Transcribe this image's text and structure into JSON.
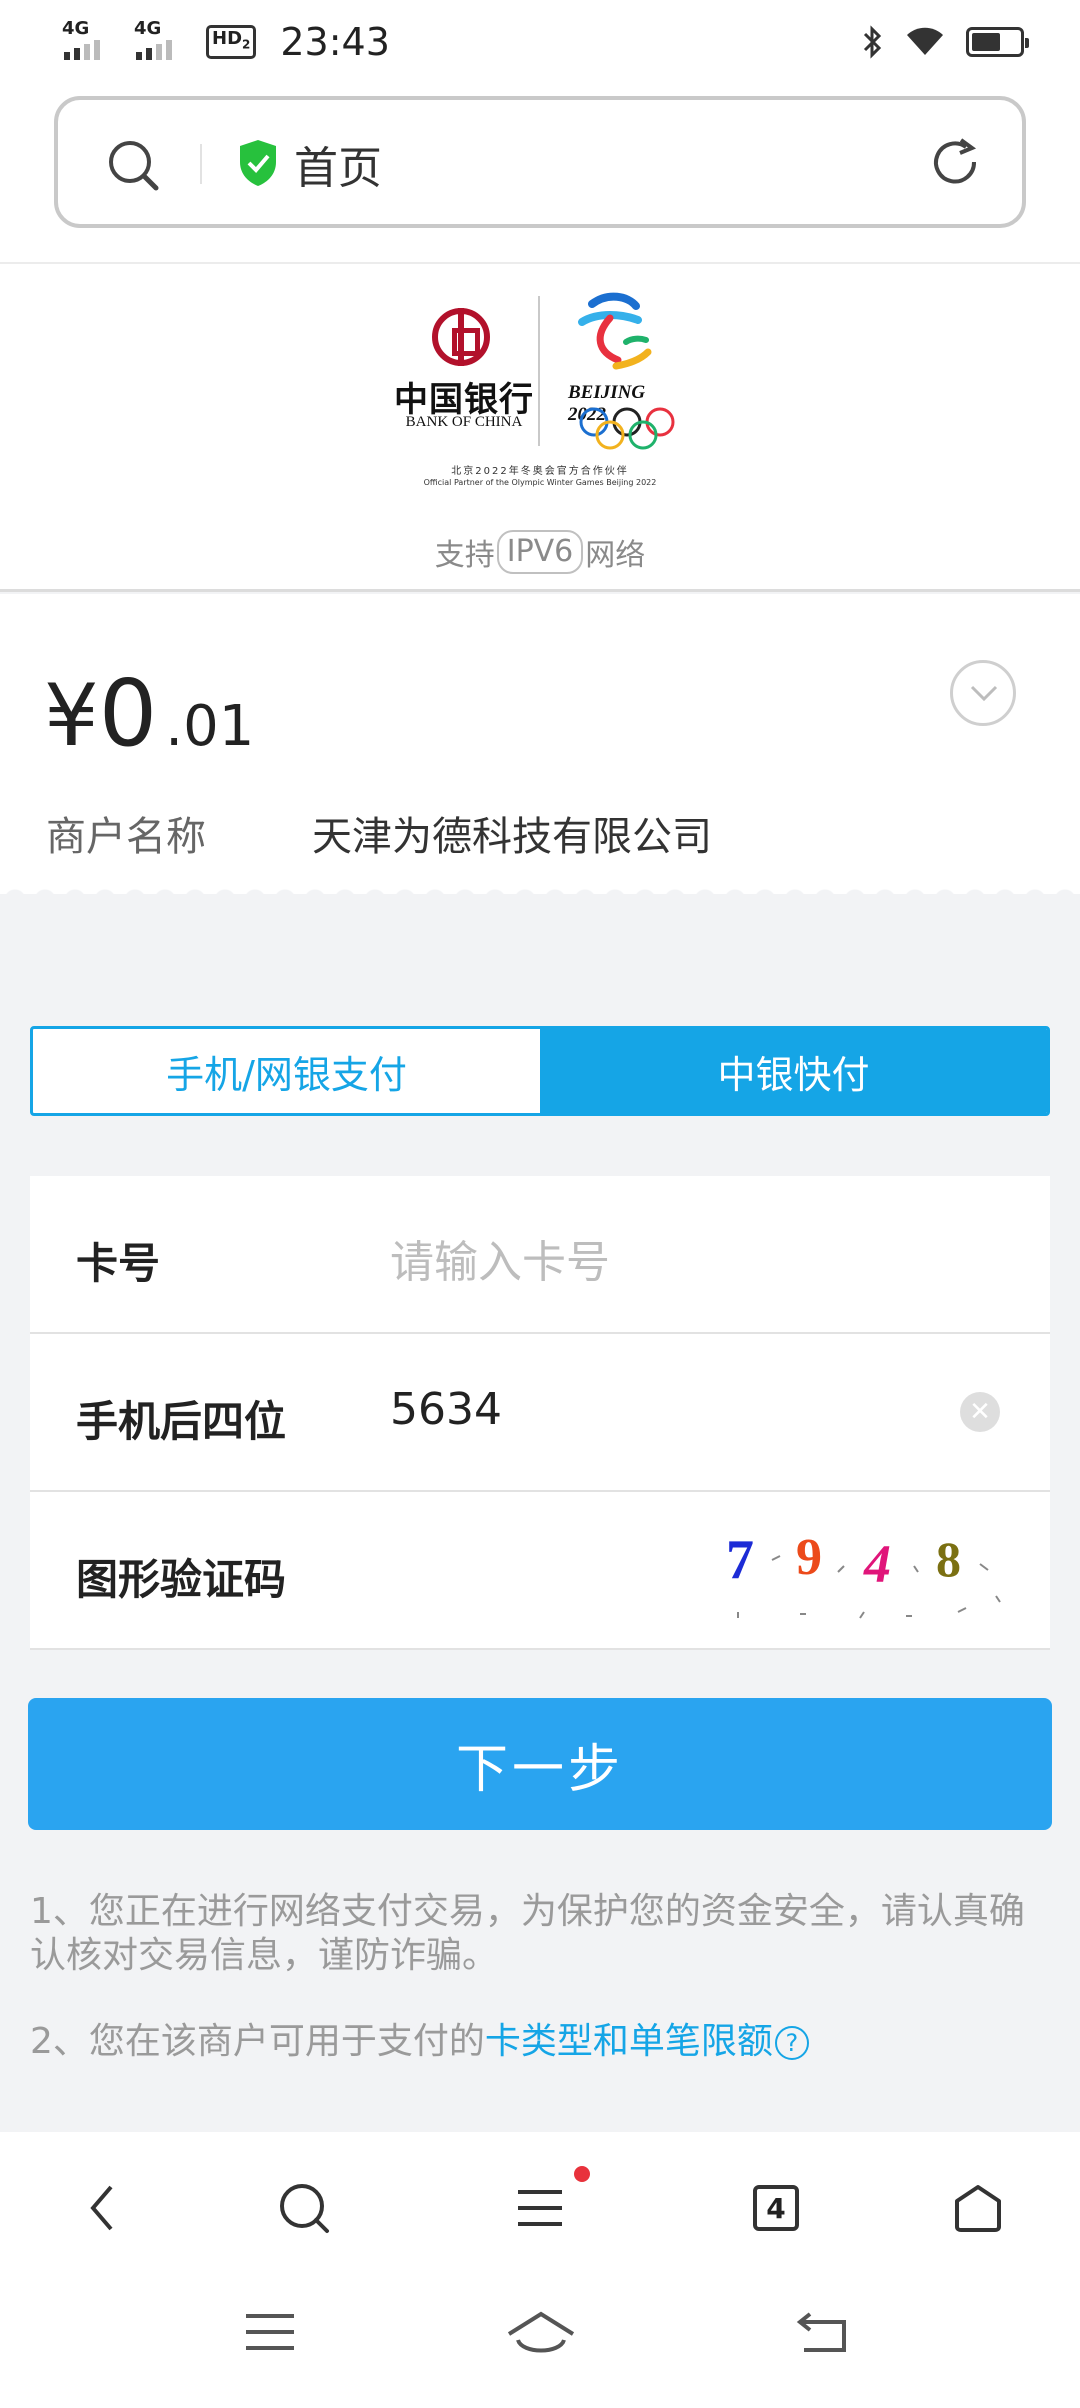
{
  "status_bar": {
    "signal1": "4G",
    "signal2": "4G",
    "hd": "HD",
    "hd_sub": "2",
    "time": "23:43",
    "battery_level": 0.6
  },
  "address_bar": {
    "title": "首页"
  },
  "bank_header": {
    "bank_name_cn": "中国银行",
    "bank_name_en": "BANK OF CHINA",
    "games_text": "BEIJING 2022",
    "partner_cn": "北京2022年冬奥会官方合作伙伴",
    "partner_en": "Official Partner of the Olympic Winter Games Beijing 2022",
    "ipv6_prefix": "支持",
    "ipv6_badge": "IPV6",
    "ipv6_suffix": "网络"
  },
  "payment": {
    "currency": "¥",
    "amount_int": "0",
    "amount_dec": ".01",
    "merchant_label": "商户名称",
    "merchant_value": "天津为德科技有限公司"
  },
  "tabs": [
    {
      "label": "手机/网银支付",
      "active": false
    },
    {
      "label": "中银快付",
      "active": true
    }
  ],
  "form": {
    "card_label": "卡号",
    "card_placeholder": "请输入卡号",
    "phone_label": "手机后四位",
    "phone_value": "5634",
    "captcha_label": "图形验证码",
    "captcha_chars": [
      "7",
      "9",
      "4",
      "8"
    ]
  },
  "next_button": "下一步",
  "notes": {
    "note1": "1、您正在进行网络支付交易，为保护您的资金安全，请认真确认核对交易信息，谨防诈骗。",
    "note2_prefix": "2、您在该商户可用于支付的",
    "note2_link": "卡类型和单笔限额",
    "help_glyph": "?"
  },
  "toolbar": {
    "tabs_count": "4"
  },
  "colors": {
    "accent": "#15a5e6",
    "button": "#2aa4f0",
    "bank_red": "#b2112b"
  }
}
